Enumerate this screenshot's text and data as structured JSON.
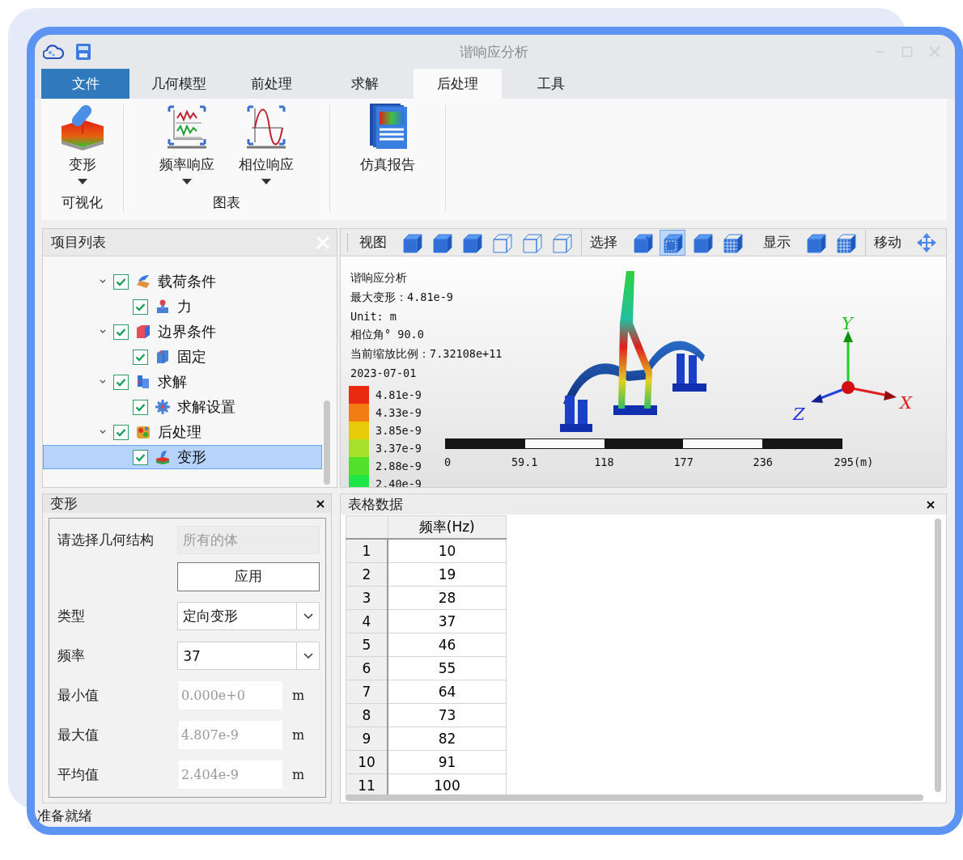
{
  "window": {
    "title": "谐响应分析"
  },
  "tabs": [
    {
      "label": "文件",
      "kind": "file",
      "selected": false
    },
    {
      "label": "几何模型",
      "kind": "tab",
      "selected": false
    },
    {
      "label": "前处理",
      "kind": "tab",
      "selected": false
    },
    {
      "label": "求解",
      "kind": "tab",
      "selected": false
    },
    {
      "label": "后处理",
      "kind": "tab",
      "selected": true
    },
    {
      "label": "工具",
      "kind": "tab",
      "selected": false
    }
  ],
  "ribbon": {
    "groups": [
      {
        "label": "可视化",
        "buttons": [
          {
            "label": "变形",
            "dropdown": true
          }
        ]
      },
      {
        "label": "图表",
        "buttons": [
          {
            "label": "频率响应",
            "dropdown": true
          },
          {
            "label": "相位响应",
            "dropdown": true
          }
        ]
      },
      {
        "buttons": [
          {
            "label": "仿真报告",
            "dropdown": false
          }
        ]
      }
    ]
  },
  "project_panel": {
    "title": "项目列表",
    "tree": [
      {
        "label": "载荷条件",
        "checked": true,
        "expanded": true,
        "selected": false,
        "children": [
          {
            "label": "力",
            "checked": true,
            "selected": false
          }
        ]
      },
      {
        "label": "边界条件",
        "checked": true,
        "expanded": true,
        "selected": false,
        "children": [
          {
            "label": "固定",
            "checked": true,
            "selected": false
          }
        ]
      },
      {
        "label": "求解",
        "checked": true,
        "expanded": true,
        "selected": false,
        "children": [
          {
            "label": "求解设置",
            "checked": true,
            "selected": false
          }
        ]
      },
      {
        "label": "后处理",
        "checked": true,
        "expanded": true,
        "selected": false,
        "children": [
          {
            "label": "变形",
            "checked": true,
            "selected": true
          }
        ]
      }
    ]
  },
  "viewer": {
    "toolbar": [
      {
        "label": "视图",
        "tools": [
          {
            "selected": false
          },
          {
            "selected": false
          },
          {
            "selected": false
          },
          {
            "selected": false
          },
          {
            "selected": false
          },
          {
            "selected": false
          }
        ]
      },
      {
        "label": "选择",
        "tools": [
          {
            "selected": false
          },
          {
            "selected": true
          },
          {
            "selected": false
          },
          {
            "selected": false
          }
        ]
      },
      {
        "label": "显示",
        "tools": [
          {
            "selected": false
          },
          {
            "selected": false
          }
        ]
      },
      {
        "label": "移动",
        "tools": [
          {
            "selected": false
          }
        ]
      }
    ],
    "info": [
      "谐响应分析",
      "最大变形：4.81e-9",
      "Unit: m",
      "相位角°  90.0",
      "当前缩放比例：7.32108e+11",
      "2023-07-01"
    ],
    "legend": [
      {
        "label": "4.81e-9",
        "color": "#ea2a10"
      },
      {
        "label": "4.33e-9",
        "color": "#f07c12"
      },
      {
        "label": "3.85e-9",
        "color": "#e6cc08"
      },
      {
        "label": "3.37e-9",
        "color": "#a6e02a"
      },
      {
        "label": "2.88e-9",
        "color": "#52e02a"
      },
      {
        "label": "2.40e-9",
        "color": "#1ee646"
      }
    ],
    "scale_bar": [
      "0",
      "59.1",
      "118",
      "177",
      "236",
      "295(m)"
    ],
    "axes": [
      {
        "label": "Y"
      },
      {
        "label": "X"
      },
      {
        "label": "Z"
      }
    ]
  },
  "property_panel": {
    "title": "变形",
    "fields": [
      {
        "kind": "text",
        "label": "请选择几何结构",
        "value": "所有的体",
        "disabled": true
      },
      {
        "kind": "button",
        "label": "应用"
      },
      {
        "kind": "select",
        "label": "类型",
        "value": "定向变形"
      },
      {
        "kind": "select",
        "label": "频率",
        "value": "37"
      },
      {
        "kind": "readout",
        "label": "最小值",
        "value": "0.000e+0",
        "unit": "m"
      },
      {
        "kind": "readout",
        "label": "最大值",
        "value": "4.807e-9",
        "unit": "m"
      },
      {
        "kind": "readout",
        "label": "平均值",
        "value": "2.404e-9",
        "unit": "m"
      }
    ]
  },
  "table_panel": {
    "title": "表格数据",
    "columns": [
      "频率(Hz)"
    ],
    "rows": [
      {
        "index": "1",
        "value": "10"
      },
      {
        "index": "2",
        "value": "19"
      },
      {
        "index": "3",
        "value": "28"
      },
      {
        "index": "4",
        "value": "37"
      },
      {
        "index": "5",
        "value": "46"
      },
      {
        "index": "6",
        "value": "55"
      },
      {
        "index": "7",
        "value": "64"
      },
      {
        "index": "8",
        "value": "73"
      },
      {
        "index": "9",
        "value": "82"
      },
      {
        "index": "10",
        "value": "91"
      },
      {
        "index": "11",
        "value": "100"
      }
    ]
  },
  "status_bar": "准备就绪"
}
